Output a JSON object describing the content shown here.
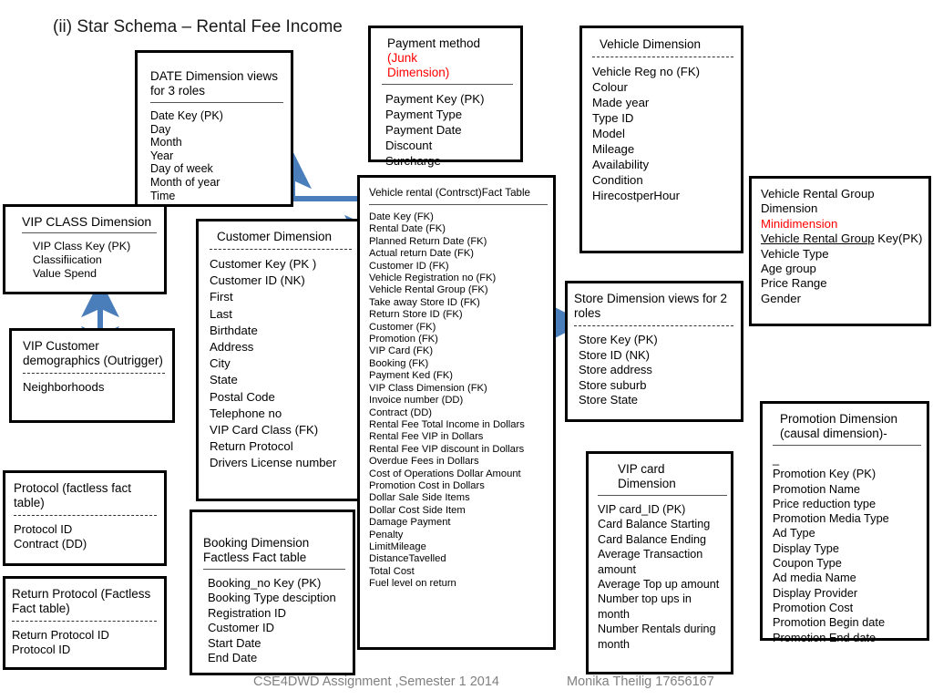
{
  "slide": {
    "title": "(ii) Star Schema – Rental Fee Income",
    "footer_left": "CSE4DWD    Assignment ,Semester 1 2014",
    "footer_right": "Monika Theilig    17656167"
  },
  "colors": {
    "accent_arrow": "#4a7ebb",
    "annotation_red": "#ff0000",
    "border": "#000000",
    "footer_text": "#808080"
  },
  "entities": {
    "date_dimension": {
      "title": "DATE Dimension views\nfor 3 roles",
      "attributes": "Date Key (PK)\nDay\nMonth\nYear\nDay of week\nMonth of year\nTime"
    },
    "payment_method": {
      "title_main": "Payment method ",
      "title_note": "(Junk\nDimension)",
      "attributes": "Payment Key (PK)\nPayment Type\nPayment Date\nDiscount\nSurcharge"
    },
    "vehicle_dimension": {
      "title": "Vehicle Dimension",
      "attributes": "Vehicle Reg no (FK)\nColour\nMade year\nType ID\nModel\nMileage\nAvailability\nCondition\nHirecostperHour"
    },
    "vip_class_dimension": {
      "title": "VIP CLASS Dimension",
      "attributes": "VIP Class Key (PK)\nClassifiication\nValue Spend"
    },
    "vip_customer_demographics": {
      "title": "VIP Customer\ndemographics (Outrigger)",
      "attributes": "Neighborhoods"
    },
    "customer_dimension": {
      "title": "Customer Dimension",
      "attributes": "Customer Key (PK )\nCustomer ID  (NK)\nFirst\nLast\nBirthdate\nAddress\nCity\nState\nPostal Code\nTelephone no\nVIP Card Class (FK)\nReturn Protocol\nDrivers License number"
    },
    "vehicle_rental_fact": {
      "title": "Vehicle rental (Contrsct)Fact Table",
      "attributes": "Date Key  (FK)\nRental Date (FK)\nPlanned  Return Date (FK)\nActual return Date (FK)\nCustomer ID (FK)\nVehicle Registration no (FK)\nVehicle Rental Group  (FK)\nTake away Store ID (FK)\nReturn Store ID (FK)\nCustomer (FK)\nPromotion (FK)\nVIP Card (FK)\nBooking (FK)\nPayment Ked (FK)\nVIP Class Dimension (FK)\nInvoice number (DD)\nContract (DD)\nRental Fee Total Income in Dollars\nRental Fee VIP in Dollars\nRental Fee VIP discount in Dollars\nOverdue Fees in Dollars\nCost of Operations Dollar Amount\nPromotion Cost in Dollars\nDollar Sale Side Items\nDollar Cost Side Item\nDamage Payment\nPenalty\nLimitMileage\nDistanceTavelled\nTotal Cost\nFuel level on return"
    },
    "store_dimension": {
      "title": "Store Dimension views for 2\nroles",
      "attributes": "Store Key (PK)\nStore ID (NK)\nStore address\nStore suburb\nStore State"
    },
    "vehicle_rental_group": {
      "title_line1": "Vehicle Rental Group",
      "title_line2": "Dimension",
      "title_note": "Minidimension",
      "key_underlined": "Vehicle Rental Group",
      "key_rest": " Key(PK)",
      "attributes": "Vehicle Type\nAge group\nPrice Range\nGender"
    },
    "vip_card_dimension": {
      "title": "VIP card\nDimension",
      "attributes": "VIP card_ID (PK)\nCard Balance Starting\nCard Balance Ending\nAverage Transaction\namount\nAverage Top up amount\nNumber top ups in\nmonth\nNumber Rentals during\nmonth"
    },
    "promotion_dimension": {
      "title": "Promotion Dimension\n(causal dimension)-",
      "subnote": "_",
      "attributes": "Promotion Key (PK)\nPromotion Name\nPrice reduction type\nPromotion Media Type\nAd Type\nDisplay Type\nCoupon Type\nAd media Name\nDisplay Provider\nPromotion Cost\nPromotion Begin date\nPromotion End date"
    },
    "protocol_factless": {
      "title": "Protocol (factless fact\ntable)",
      "attributes": "Protocol ID\nContract (DD)"
    },
    "return_protocol_factless": {
      "title": "Return Protocol (Factless\nFact table)",
      "attributes": "Return Protocol ID\nProtocol ID"
    },
    "booking_factless": {
      "title": "Booking Dimension\nFactless Fact table",
      "attributes": "Booking_no Key (PK)\nBooking Type desciption\nRegistration ID\nCustomer ID\nStart Date\nEnd Date"
    }
  },
  "connectors": [
    {
      "name": "fact-to-date-elbow",
      "kind": "elbow-arrow-up"
    },
    {
      "name": "fact-to-store-double",
      "kind": "double-arrow-horizontal"
    },
    {
      "name": "vipclass-to-demographics",
      "kind": "double-arrow-vertical"
    }
  ]
}
